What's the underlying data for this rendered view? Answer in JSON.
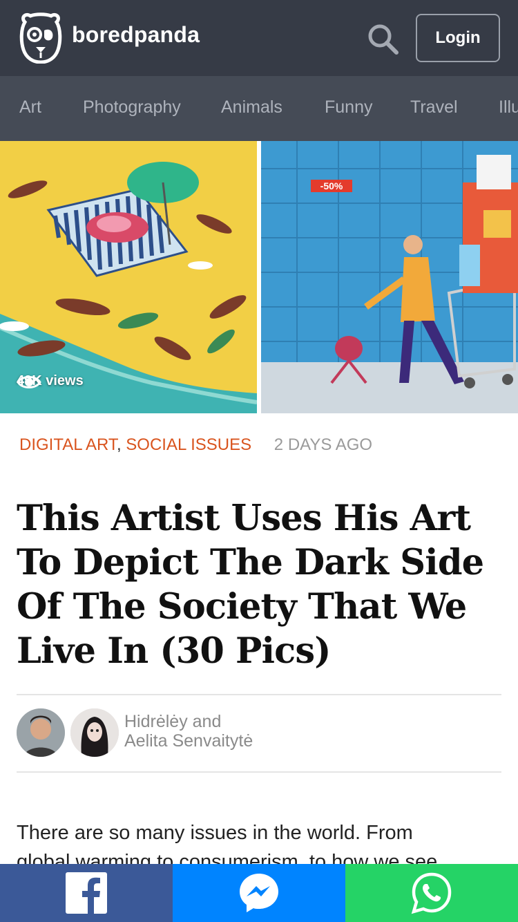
{
  "header": {
    "brand": "boredpanda",
    "login_label": "Login"
  },
  "nav": {
    "categories": [
      "Art",
      "Photography",
      "Animals",
      "Funny",
      "Travel",
      "Illu"
    ]
  },
  "hero": {
    "views": "49K views",
    "price_tag": "-50%"
  },
  "article": {
    "categories": [
      "DIGITAL ART",
      "SOCIAL ISSUES"
    ],
    "separator": ",",
    "time_ago": "2 DAYS AGO",
    "title": "This Artist Uses His Art To Depict The Dark Side Of The Society That We Live In (30 Pics)",
    "authors_line1": "Hidrėlėy and",
    "authors_line2": "Aelita Senvaitytė",
    "body_line1": "There are so many issues in the world. From",
    "body_line2": "global warming to consumerism, to how we see"
  },
  "share": {
    "icons": [
      "facebook-icon",
      "messenger-icon",
      "whatsapp-icon"
    ]
  },
  "colors": {
    "header_bg": "#363b46",
    "nav_bg": "#454b56",
    "accent": "#d9541e",
    "facebook": "#3b5998",
    "messenger": "#0084ff",
    "whatsapp": "#25d366"
  }
}
